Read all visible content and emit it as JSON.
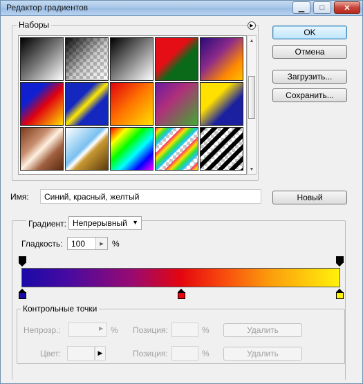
{
  "window": {
    "title": "Редактор градиентов",
    "close_glyph": "✕",
    "min_glyph": "▁",
    "max_glyph": "□"
  },
  "presets": {
    "label": "Наборы",
    "menu_icon": "right-arrow-circle-icon",
    "swatches": [
      "linear-gradient(135deg,#000 0%,#777 50%,#fff 100%)",
      "checker-dark",
      "linear-gradient(135deg,#000 0%,#fff 100%)",
      "linear-gradient(135deg,#e60e16 0%,#e60e16 40%,#0a6a1a 60%,#0a6a1a 100%)",
      "linear-gradient(135deg,#2a0a7a 0%,#8a2a8a 40%,#ff8a00 75%,#ffc000 100%)",
      "linear-gradient(135deg,#1020d0 0%,#1020d0 30%,#e00010 55%,#ffe000 100%)",
      "linear-gradient(135deg,#1428c0 0%,#1428c0 35%,#ffe800 50%,#1428c0 65%,#1428c0 100%)",
      "linear-gradient(135deg,#e00010 0%,#ff7800 50%,#ffe000 100%)",
      "linear-gradient(135deg,#6a1aa0 0%,#b0307a 40%,#40aa30 100%)",
      "linear-gradient(135deg,#ffe000 0%,#ffe000 35%,#1a20a0 65%,#1a20a0 100%)",
      "linear-gradient(135deg,#7a3a1a 0%,#c89070 35%,#fff0e0 50%,#a06040 70%,#5a2a10 100%)",
      "linear-gradient(135deg,#fff 0%,#7ac0f0 45%,#fff 52%,#c89830 60%,#5a3a10 100%)",
      "linear-gradient(135deg,#ff0000 0%,#ffff00 20%,#00ff00 40%,#00ffff 60%,#0000ff 80%,#ff00ff 100%)",
      "rainbow-stripes",
      "black-white-stripes"
    ]
  },
  "buttons": {
    "ok": "OK",
    "cancel": "Отмена",
    "load": "Загрузить...",
    "save": "Сохранить...",
    "new": "Новый"
  },
  "name": {
    "label": "Имя:",
    "value": "Синий, красный, желтый"
  },
  "gradient": {
    "type_label": "Градиент:",
    "type_value": "Непрерывный",
    "smoothness_label": "Гладкость:",
    "smoothness_value": "100",
    "smoothness_unit": "%",
    "stops_top": [
      {
        "position": 0.0,
        "color": "#000000"
      },
      {
        "position": 1.0,
        "color": "#000000"
      }
    ],
    "stops_bottom": [
      {
        "position": 0.0,
        "color": "#1a0aa8"
      },
      {
        "position": 0.5,
        "color": "#e4060e"
      },
      {
        "position": 1.0,
        "color": "#fff20a"
      }
    ]
  },
  "control_points": {
    "label": "Контрольные точки",
    "opacity_label": "Непрозр.:",
    "position_label": "Позиция:",
    "color_label": "Цвет:",
    "percent": "%",
    "delete_label": "Удалить"
  }
}
